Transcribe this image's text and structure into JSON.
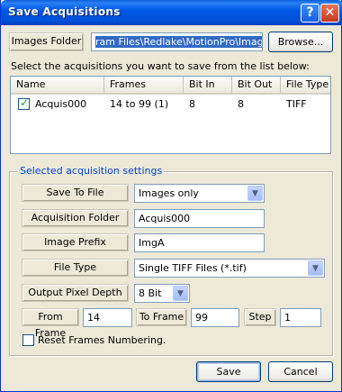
{
  "window": {
    "title": "Save Acquisitions",
    "help_glyph": "?",
    "close_glyph": "✕"
  },
  "images_folder": {
    "label": "Images Folder",
    "value": "ram Files\\Redlake\\MotionPro\\Images\\",
    "browse_label": "Browse..."
  },
  "instruction": "Select the acquisitions you want to save from the list below:",
  "list": {
    "columns": [
      "Name",
      "Frames",
      "Bit In",
      "Bit Out",
      "File Type"
    ],
    "rows": [
      {
        "checked": true,
        "name": "Acquis000",
        "frames": "14 to 99 (1)",
        "bit_in": "8",
        "bit_out": "8",
        "file_type": "TIFF"
      }
    ]
  },
  "settings": {
    "group_title": "Selected acquisition settings",
    "save_to_file": {
      "label": "Save To File",
      "value": "Images only"
    },
    "acquisition_folder": {
      "label": "Acquisition Folder",
      "value": "Acquis000"
    },
    "image_prefix": {
      "label": "Image Prefix",
      "value": "ImgA"
    },
    "file_type": {
      "label": "File Type",
      "value": "Single TIFF Files (*.tif)"
    },
    "output_pixel_depth": {
      "label": "Output Pixel Depth",
      "value": "8 Bit"
    },
    "from_frame": {
      "label": "From Frame",
      "value": "14"
    },
    "to_frame": {
      "label": "To Frame",
      "value": "99"
    },
    "step": {
      "label": "Step",
      "value": "1"
    },
    "reset_frames": {
      "label": "Reset Frames Numbering.",
      "checked": false
    }
  },
  "footer": {
    "save_label": "Save",
    "cancel_label": "Cancel"
  },
  "dropdown_glyph": "▼",
  "colors": {
    "title_bar": "#0058e6",
    "selection": "#316ac5",
    "group_title": "#0046d5",
    "dialog_bg": "#ece9d8"
  }
}
